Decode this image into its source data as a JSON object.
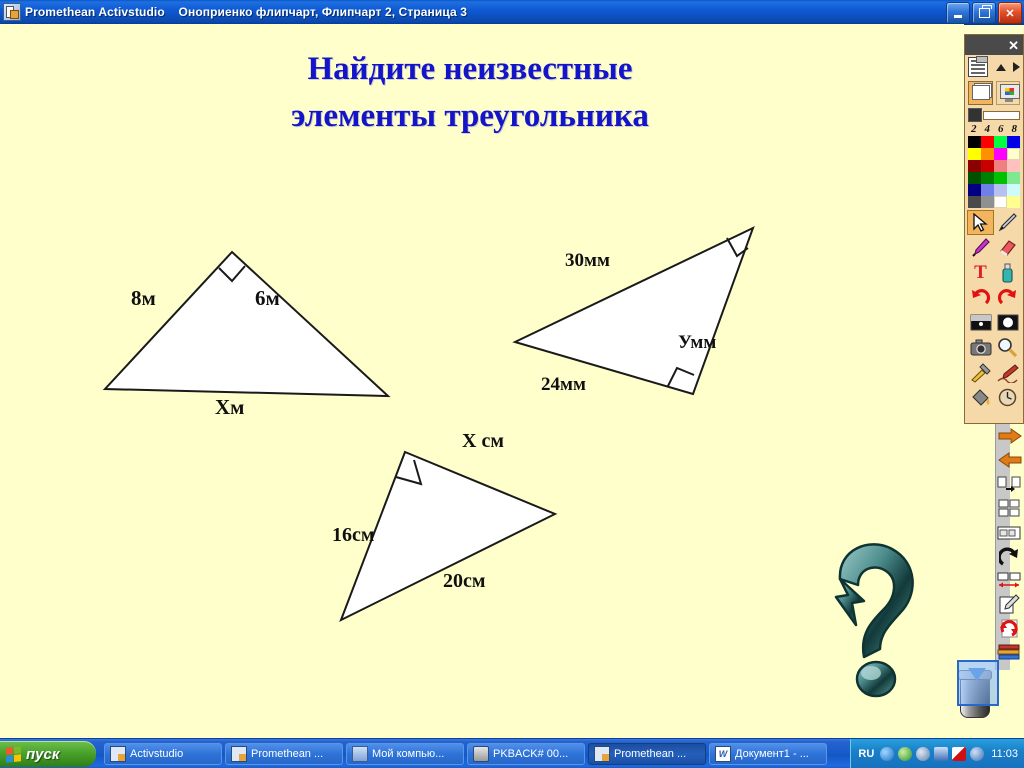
{
  "window": {
    "app_title": "Promethean Activstudio",
    "document_title": "Оноприенко флипчарт,  Флипчарт 2,  Страница 3",
    "icon": "activstudio-icon",
    "buttons": {
      "minimize": "minimize-button",
      "restore": "restore-button",
      "close": "close-button"
    }
  },
  "slide": {
    "title_line1": "Найдите неизвестные",
    "title_line2": "элементы треугольника",
    "title_color": "#1414C8",
    "background_color": "#FFFFCC",
    "figures": [
      {
        "id": "triangle-1",
        "right_angle_at": "apex",
        "labels": [
          {
            "text": "8м",
            "position": "left-side"
          },
          {
            "text": "6м",
            "position": "right-side"
          },
          {
            "text": "Хм",
            "position": "bottom-side"
          }
        ]
      },
      {
        "id": "triangle-2",
        "right_angle_at": "bottom-vertex",
        "labels": [
          {
            "text": "30мм",
            "position": "upper-left-side"
          },
          {
            "text": "24мм",
            "position": "lower-left-side"
          },
          {
            "text": "Умм",
            "position": "right-side"
          }
        ]
      },
      {
        "id": "triangle-3",
        "right_angle_at": "top-vertex",
        "labels": [
          {
            "text": "Х см",
            "position": "top-side"
          },
          {
            "text": "16см",
            "position": "left-side"
          },
          {
            "text": "20см",
            "position": "lower-right-side"
          }
        ]
      }
    ],
    "decoration": {
      "name": "question-mark-graphic",
      "color": "#4E8C8C"
    }
  },
  "toolbox": {
    "close_label": "✕",
    "page_icon": "page-properties-icon",
    "up_arrow": "scroll-up-arrow",
    "right_arrow": "expand-right-arrow",
    "mode_annotate": "annotate-over-desktop-button",
    "mode_desktop": "desktop-mode-button",
    "pen_width_swatch": "#333333",
    "pen_widths": [
      "2",
      "4",
      "6",
      "8"
    ],
    "palette": [
      [
        "#000000",
        "#FF0000",
        "#00FF40",
        "#0000E8"
      ],
      [
        "#FFFF00",
        "#FF9000",
        "#FF00FF",
        "#FFFFCC"
      ],
      [
        "#8B0000",
        "#C80000",
        "#F08080",
        "#FFC0C0"
      ],
      [
        "#005000",
        "#008000",
        "#00C000",
        "#80E890"
      ],
      [
        "#000080",
        "#7080E8",
        "#B8C0F0",
        "#CFFAFA"
      ],
      [
        "#4A4A4A",
        "#909090",
        "#FFFFFF",
        "#FFFF90"
      ]
    ],
    "tools": [
      {
        "name": "select-tool-icon",
        "label": "Select",
        "selected": true
      },
      {
        "name": "pen-tool-icon",
        "label": "Pen",
        "selected": false
      },
      {
        "name": "highlighter-tool-icon",
        "label": "Highlighter",
        "selected": false
      },
      {
        "name": "eraser-tool-icon",
        "label": "Eraser",
        "selected": false
      },
      {
        "name": "text-tool-icon",
        "label": "Text",
        "selected": false
      },
      {
        "name": "spray-can-icon",
        "label": "Fill / Spray",
        "selected": false
      },
      {
        "name": "undo-icon",
        "label": "Undo",
        "selected": false
      },
      {
        "name": "redo-icon",
        "label": "Redo",
        "selected": false
      },
      {
        "name": "blind-tool-icon",
        "label": "Revealer",
        "selected": false
      },
      {
        "name": "spotlight-tool-icon",
        "label": "Spotlight",
        "selected": false
      },
      {
        "name": "camera-tool-icon",
        "label": "Camera",
        "selected": false
      },
      {
        "name": "magnifier-tool-icon",
        "label": "Magnifier",
        "selected": false
      },
      {
        "name": "tools-icon",
        "label": "Tools",
        "selected": false
      },
      {
        "name": "handwriting-icon",
        "label": "Handwriting recognition",
        "selected": false
      },
      {
        "name": "fill-bucket-icon",
        "label": "Fill",
        "selected": false
      },
      {
        "name": "clock-tool-icon",
        "label": "Clock",
        "selected": false
      }
    ]
  },
  "sidebar": {
    "items": [
      {
        "name": "next-page-arrow-icon",
        "label": "Next page"
      },
      {
        "name": "previous-page-arrow-icon",
        "label": "Previous page"
      },
      {
        "name": "insert-page-icon",
        "label": "Insert page"
      },
      {
        "name": "page-thumbnails-icon",
        "label": "Page thumbnails"
      },
      {
        "name": "page-organiser-icon",
        "label": "Page organiser"
      },
      {
        "name": "redo-arrow-icon",
        "label": "Redo"
      },
      {
        "name": "page-size-icon",
        "label": "Page size"
      },
      {
        "name": "notes-icon",
        "label": "Notes"
      },
      {
        "name": "reset-page-icon",
        "label": "Reset page"
      },
      {
        "name": "resource-library-icon",
        "label": "Resource library"
      }
    ],
    "trash": {
      "name": "trash-bin-icon",
      "label": "Delete"
    },
    "scrollbar": {
      "name": "vertical-scrollbar"
    }
  },
  "taskbar": {
    "start_label": "пуск",
    "items": [
      {
        "label": "Activstudio",
        "icon": "activstudio-icon",
        "active": false
      },
      {
        "label": "Promethean ...",
        "icon": "activstudio-icon",
        "active": false
      },
      {
        "label": "Мой компью...",
        "icon": "my-computer-icon",
        "active": false
      },
      {
        "label": "PKBACK# 00...",
        "icon": "drive-icon",
        "active": false
      },
      {
        "label": "Promethean ...",
        "icon": "activstudio-icon",
        "active": true
      },
      {
        "label": "Документ1 - ...",
        "icon": "word-icon",
        "active": false
      }
    ],
    "tray": {
      "language": "RU",
      "icons": [
        "back-arrow-icon",
        "network-icon",
        "volume-icon",
        "display-icon",
        "kaspersky-icon",
        "network-status-icon"
      ],
      "clock": "11:03"
    }
  }
}
